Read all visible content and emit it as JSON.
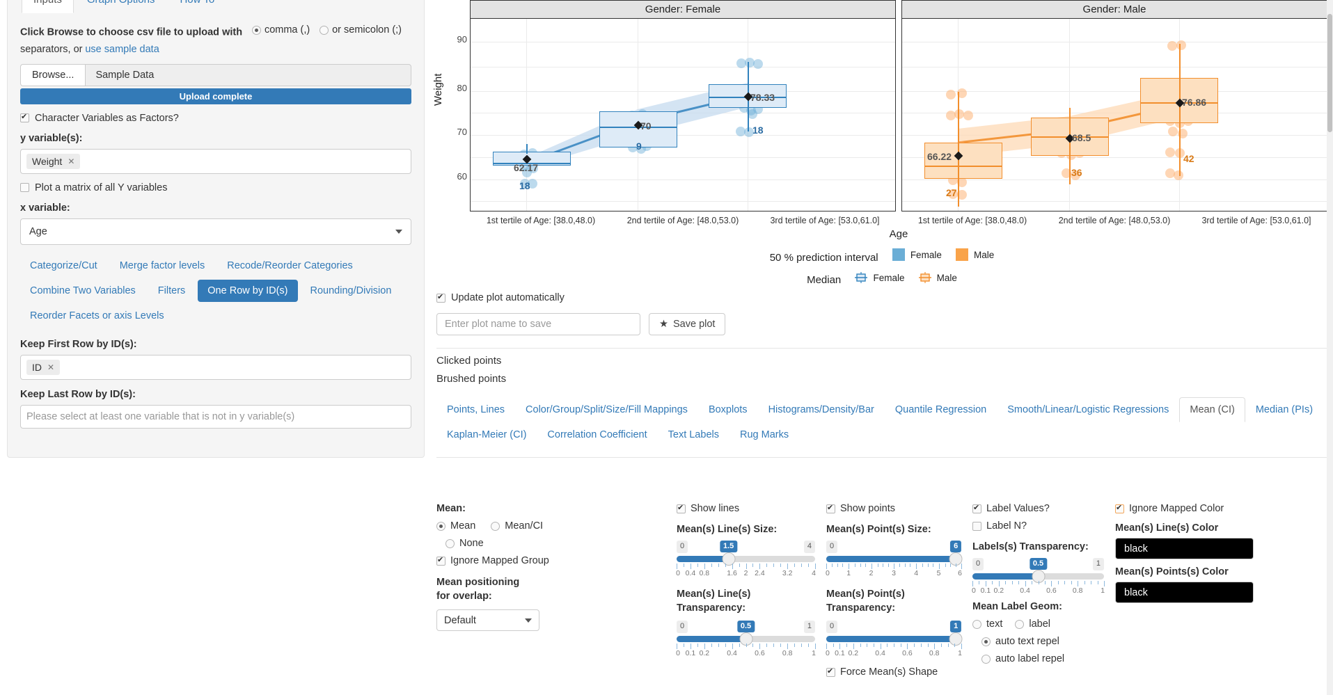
{
  "sidebar": {
    "tabs": [
      {
        "label": "Inputs",
        "active": true
      },
      {
        "label": "Graph Options",
        "active": false
      },
      {
        "label": "How To",
        "active": false
      }
    ],
    "upload_prompt": "Click Browse to choose csv file to upload with",
    "sep_comma": "comma (,)",
    "sep_semicolon": "or semicolon (;)",
    "sep_tail": "separators, or",
    "sample_link": "use sample data",
    "browse_button": "Browse...",
    "file_name": "Sample Data",
    "progress_label": "Upload complete",
    "factors_label": "Character Variables as Factors?",
    "y_label": "y variable(s):",
    "y_value": "Weight",
    "matrix_label": "Plot a matrix of all Y variables",
    "x_label": "x variable:",
    "x_value": "Age",
    "pills": [
      {
        "label": "Categorize/Cut",
        "active": false
      },
      {
        "label": "Merge factor levels",
        "active": false
      },
      {
        "label": "Recode/Reorder Categories",
        "active": false
      },
      {
        "label": "Combine Two Variables",
        "active": false
      },
      {
        "label": "Filters",
        "active": false
      },
      {
        "label": "One Row by ID(s)",
        "active": true
      },
      {
        "label": "Rounding/Division",
        "active": false
      },
      {
        "label": "Reorder Facets or axis Levels",
        "active": false
      }
    ],
    "keep_first_label": "Keep First Row by ID(s):",
    "keep_first_value": "ID",
    "keep_last_label": "Keep Last Row by ID(s):",
    "keep_last_placeholder": "Please select at least one variable that is not in y variable(s)"
  },
  "plot": {
    "facets": [
      {
        "strip": "Gender: Female"
      },
      {
        "strip": "Gender: Male"
      }
    ],
    "ylabel": "Weight",
    "xlabel": "Age",
    "yticks": [
      "90",
      "80",
      "70",
      "60"
    ],
    "xticks": [
      "1st tertile of Age: [38.0,48.0)",
      "2nd tertile of Age: [48.0,53.0)",
      "3rd tertile of Age: [53.0,61.0]"
    ],
    "legend": {
      "row1_title": "50 % prediction interval",
      "row1_items": [
        "Female",
        "Male"
      ],
      "row2_title": "Median",
      "row2_items": [
        "Female",
        "Male"
      ]
    },
    "auto_update_label": "Update plot automatically",
    "save_placeholder": "Enter plot name to save",
    "save_button": "Save plot",
    "clicked_points": "Clicked points",
    "brushed_points": "Brushed points"
  },
  "chart_data": {
    "type": "boxplot",
    "title": "",
    "xlabel": "Age",
    "ylabel": "Weight",
    "ylim": [
      55,
      95
    ],
    "yticks": [
      60,
      70,
      80,
      90
    ],
    "categories": [
      "1st tertile of Age: [38.0,48.0)",
      "2nd tertile of Age: [48.0,53.0)",
      "3rd tertile of Age: [53.0,61.0]"
    ],
    "facet_variable": "Gender",
    "legend_position": "bottom",
    "grid": true,
    "series": [
      {
        "name": "Female",
        "color": "#3182bd",
        "fill": "#c6dbef",
        "means": [
          62.17,
          70,
          78.33
        ],
        "n": [
          18,
          9,
          18
        ],
        "boxes": [
          {
            "q1": 60.8,
            "median": 62.3,
            "q3": 63.6,
            "lower": 59.0,
            "upper": 65.8
          },
          {
            "q1": 66.0,
            "median": 71.1,
            "q3": 74.4,
            "lower": 64.5,
            "upper": 74.5
          },
          {
            "q1": 75.2,
            "median": 78.2,
            "q3": 80.6,
            "lower": 68.5,
            "upper": 87.8
          }
        ]
      },
      {
        "name": "Male",
        "color": "#f28e2c",
        "fill": "#fdd9b5",
        "means": [
          66.22,
          68.5,
          76.86
        ],
        "n": [
          27,
          36,
          42
        ],
        "boxes": [
          {
            "q1": 62.4,
            "median": 64.8,
            "q3": 69.5,
            "lower": 55.5,
            "upper": 80.3
          },
          {
            "q1": 64.0,
            "median": 68.3,
            "q3": 71.7,
            "lower": 56.0,
            "upper": 75.5
          },
          {
            "q1": 73.5,
            "median": 77.0,
            "q3": 80.8,
            "lower": 58.0,
            "upper": 91.0
          }
        ]
      }
    ]
  },
  "tabs2": [
    {
      "label": "Points, Lines",
      "active": false
    },
    {
      "label": "Color/Group/Split/Size/Fill Mappings",
      "active": false
    },
    {
      "label": "Boxplots",
      "active": false
    },
    {
      "label": "Histograms/Density/Bar",
      "active": false
    },
    {
      "label": "Quantile Regression",
      "active": false
    },
    {
      "label": "Smooth/Linear/Logistic Regressions",
      "active": false
    },
    {
      "label": "Mean (CI)",
      "active": true
    },
    {
      "label": "Median (PIs)",
      "active": false
    },
    {
      "label": "Kaplan-Meier (CI)",
      "active": false
    },
    {
      "label": "Correlation Coefficient",
      "active": false
    },
    {
      "label": "Text Labels",
      "active": false
    },
    {
      "label": "Rug Marks",
      "active": false
    }
  ],
  "options": {
    "mean_title": "Mean:",
    "mean_radios": [
      {
        "label": "Mean",
        "selected": true
      },
      {
        "label": "Mean/CI",
        "selected": false
      },
      {
        "label": "None",
        "selected": false
      }
    ],
    "ignore_group_label": "Ignore Mapped Group",
    "positioning_title": "Mean positioning for overlap:",
    "positioning_value": "Default",
    "show_lines_label": "Show lines",
    "line_size_title": "Mean(s) Line(s) Size:",
    "line_size": {
      "value": "1.5",
      "min": "0",
      "max": "4",
      "pct": 37.5,
      "ticks": [
        "0",
        "0.4",
        "0.8",
        "1.6",
        "2",
        "2.4",
        "3.2",
        "4"
      ],
      "tickpos": [
        0,
        10,
        20,
        40,
        50,
        60,
        80,
        100
      ]
    },
    "line_transp_title": "Mean(s) Line(s) Transparency:",
    "line_transp": {
      "value": "0.5",
      "min": "0",
      "max": "1",
      "pct": 50,
      "ticks": [
        "0",
        "0.1",
        "0.2",
        "0.4",
        "0.6",
        "0.8",
        "1"
      ],
      "tickpos": [
        0,
        10,
        20,
        40,
        60,
        80,
        100
      ]
    },
    "show_points_label": "Show points",
    "point_size_title": "Mean(s) Point(s) Size:",
    "point_size": {
      "value": "6",
      "min": "0",
      "max": "6",
      "pct": 96,
      "ticks": [
        "0",
        "1",
        "2",
        "3",
        "4",
        "5",
        "6"
      ],
      "tickpos": [
        0,
        16.6,
        33.3,
        50,
        66.6,
        83.3,
        100
      ]
    },
    "point_transp_title": "Mean(s) Point(s) Transparency:",
    "point_transp": {
      "value": "1",
      "min": "0",
      "max": "1",
      "pct": 96,
      "ticks": [
        "0",
        "0.1",
        "0.2",
        "0.4",
        "0.6",
        "0.8",
        "1"
      ],
      "tickpos": [
        0,
        10,
        20,
        40,
        60,
        80,
        100
      ]
    },
    "force_shape_label": "Force Mean(s) Shape",
    "label_values_label": "Label Values?",
    "label_n_label": "Label N?",
    "labels_transp_title": "Labels(s) Transparency:",
    "labels_transp": {
      "value": "0.5",
      "min": "0",
      "max": "1",
      "pct": 50,
      "ticks": [
        "0",
        "0.1",
        "0.2",
        "0.4",
        "0.6",
        "0.8",
        "1"
      ],
      "tickpos": [
        0,
        10,
        20,
        40,
        60,
        80,
        100
      ]
    },
    "label_geom_title": "Mean Label Geom:",
    "label_geom_radios": [
      {
        "label": "text",
        "selected": false
      },
      {
        "label": "label",
        "selected": false
      },
      {
        "label": "auto text repel",
        "selected": true
      },
      {
        "label": "auto label repel",
        "selected": false
      }
    ],
    "ignore_color_label": "Ignore Mapped Color",
    "line_color_title": "Mean(s) Line(s) Color",
    "line_color_value": "black",
    "point_color_title": "Mean(s) Points(s) Color",
    "point_color_value": "black"
  }
}
